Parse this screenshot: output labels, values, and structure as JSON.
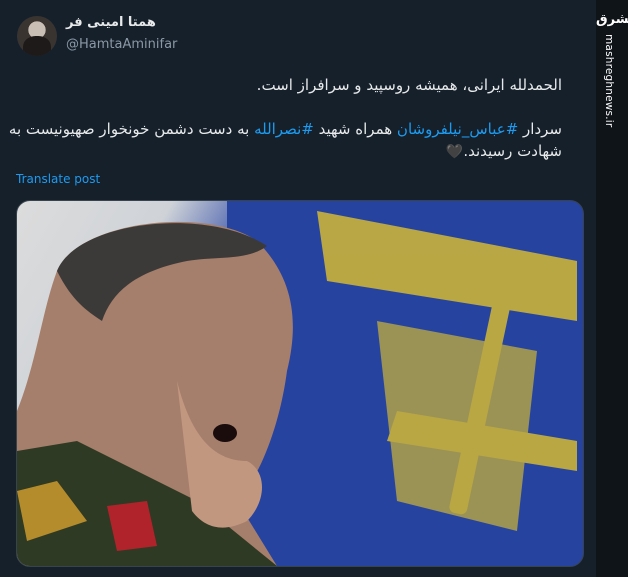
{
  "tweet": {
    "display_name": "همتا امینی فر",
    "handle": "@HamtaAminifar",
    "line1": "الحمدلله ایرانی، همیشه روسپید و سرافراز است.",
    "line2_start": "سردار ",
    "hashtag1": "#عباس_نیلفروشان",
    "line2_mid": " همراه شهید ",
    "hashtag2": "#نصرالله",
    "line2_end": " به دست دشمن خونخوار صهیونیست به شهادت رسیدند.",
    "heart": "🖤",
    "translate_label": "Translate post"
  },
  "media": {
    "description": "",
    "icon": "photo"
  },
  "sidebar": {
    "logo": "مشرق",
    "site": "mashreghnews.ir"
  },
  "colors": {
    "background": "#15202b",
    "link": "#1d9bf0",
    "text": "#e7e9ea",
    "muted": "#8b98a5"
  }
}
